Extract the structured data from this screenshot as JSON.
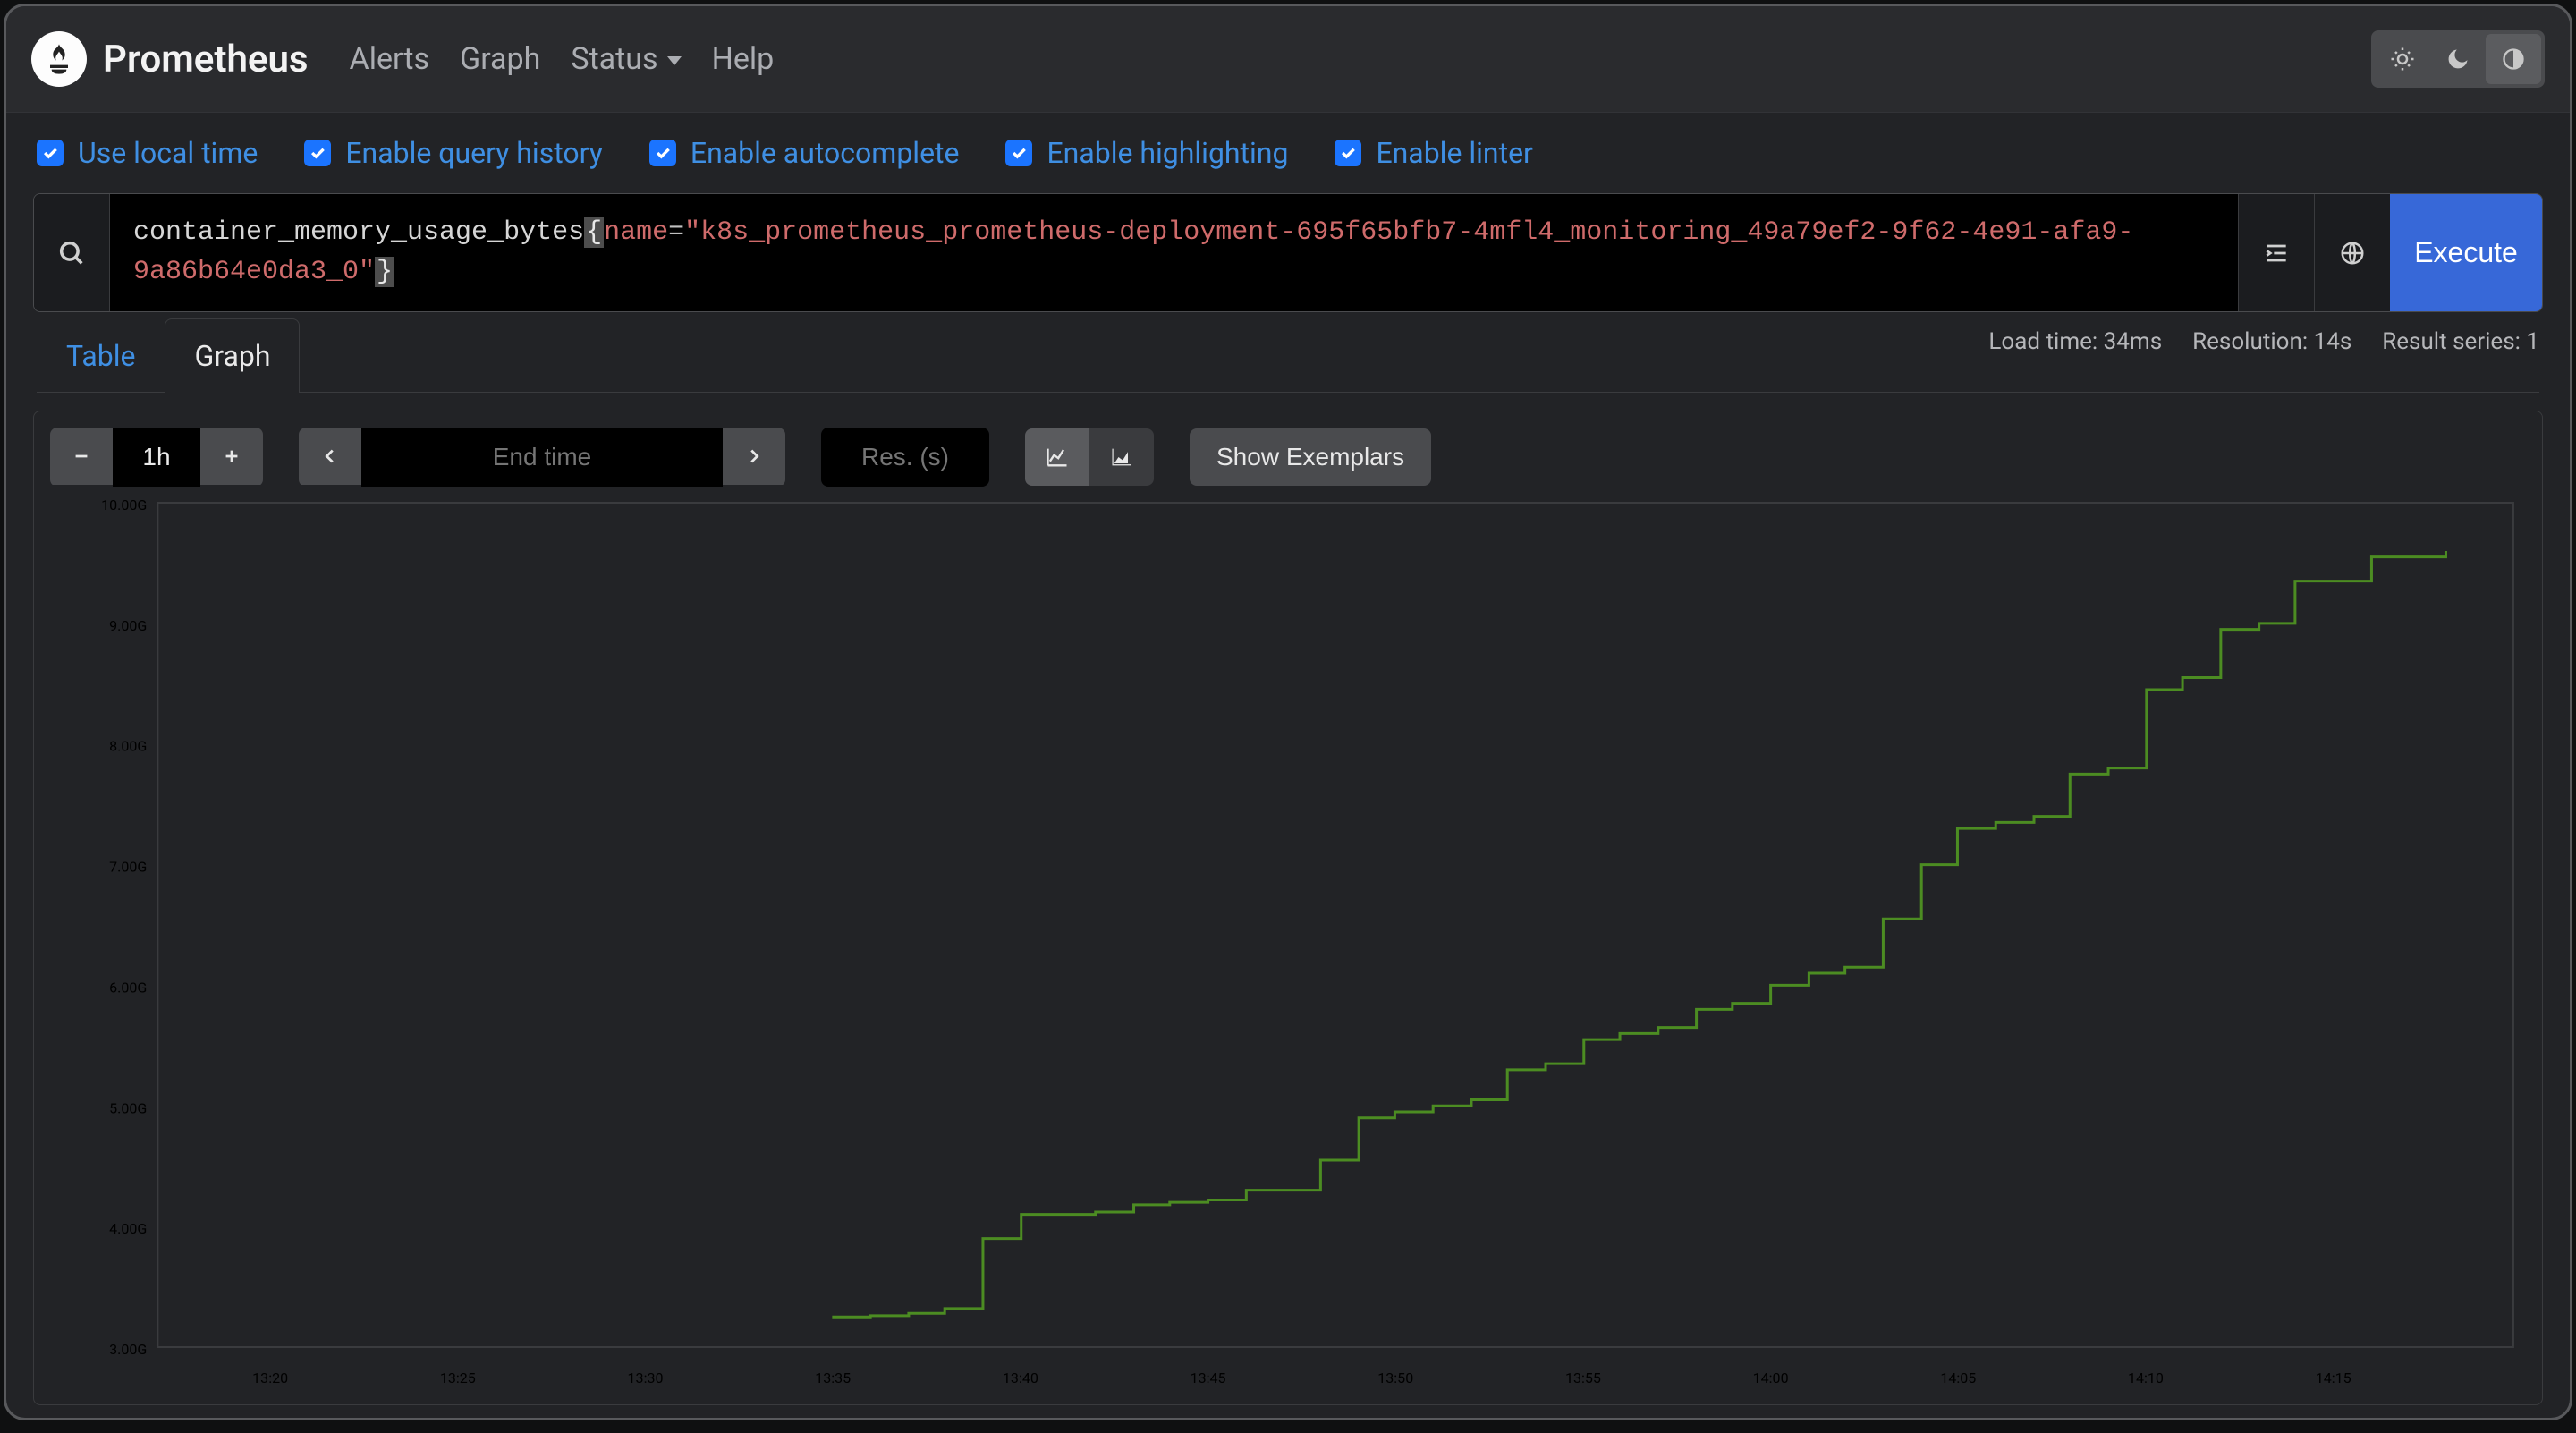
{
  "app": {
    "name": "Prometheus"
  },
  "nav": {
    "alerts": "Alerts",
    "graph": "Graph",
    "status": "Status",
    "help": "Help"
  },
  "theme_icons": {
    "sun": "sun-icon",
    "moon": "moon-icon",
    "contrast": "contrast-icon"
  },
  "options": {
    "local_time": "Use local time",
    "query_history": "Enable query history",
    "autocomplete": "Enable autocomplete",
    "highlighting": "Enable highlighting",
    "linter": "Enable linter"
  },
  "query": {
    "metric": "container_memory_usage_bytes",
    "label": "name",
    "value": "\"k8s_prometheus_prometheus-deployment-695f65bfb7-4mfl4_monitoring_49a79ef2-9f62-4e91-afa9-9a86b64e0da3_0\"",
    "full": "container_memory_usage_bytes{name=\"k8s_prometheus_prometheus-deployment-695f65bfb7-4mfl4_monitoring_49a79ef2-9f62-4e91-afa9-9a86b64e0da3_0\"}"
  },
  "execute_label": "Execute",
  "status": {
    "load_time": "Load time: 34ms",
    "resolution": "Resolution: 14s",
    "result_series": "Result series: 1"
  },
  "tabs": {
    "table": "Table",
    "graph": "Graph"
  },
  "controls": {
    "range": "1h",
    "end_time_placeholder": "End time",
    "res_placeholder": "Res. (s)",
    "show_exemplars": "Show Exemplars"
  },
  "chart_data": {
    "type": "line",
    "title": "",
    "xlabel": "",
    "ylabel": "",
    "x_categories": [
      "13:20",
      "13:25",
      "13:30",
      "13:35",
      "13:40",
      "13:45",
      "13:50",
      "13:55",
      "14:00",
      "14:05",
      "14:10",
      "14:15"
    ],
    "ylim": [
      3.0,
      10.0
    ],
    "y_ticks": [
      "3.00G",
      "4.00G",
      "5.00G",
      "6.00G",
      "7.00G",
      "8.00G",
      "9.00G",
      "10.00G"
    ],
    "series": [
      {
        "name": "container_memory_usage_bytes",
        "color": "#4c8c22",
        "x": [
          13.583,
          13.6,
          13.617,
          13.633,
          13.65,
          13.667,
          13.7,
          13.717,
          13.733,
          13.75,
          13.767,
          13.8,
          13.817,
          13.833,
          13.85,
          13.867,
          13.883,
          13.9,
          13.917,
          13.933,
          13.95,
          13.967,
          13.983,
          14.0,
          14.017,
          14.033,
          14.05,
          14.067,
          14.083,
          14.1,
          14.117,
          14.133,
          14.15,
          14.167,
          14.183,
          14.2,
          14.217,
          14.233,
          14.25,
          14.267,
          14.3
        ],
        "y": [
          3.25,
          3.26,
          3.28,
          3.32,
          3.9,
          4.1,
          4.12,
          4.18,
          4.2,
          4.22,
          4.3,
          4.55,
          4.9,
          4.95,
          5.0,
          5.05,
          5.3,
          5.35,
          5.55,
          5.6,
          5.65,
          5.8,
          5.85,
          6.0,
          6.1,
          6.15,
          6.55,
          7.0,
          7.3,
          7.35,
          7.4,
          7.75,
          7.8,
          8.45,
          8.55,
          8.95,
          9.0,
          9.35,
          9.35,
          9.55,
          9.6
        ]
      }
    ]
  }
}
